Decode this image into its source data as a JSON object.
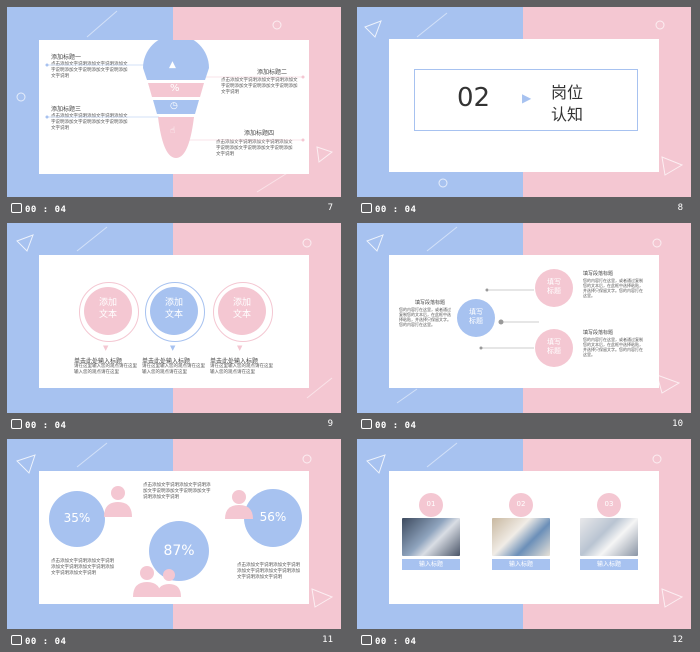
{
  "colors": {
    "blue": "#a7c2f0",
    "pink": "#f4c7d2",
    "bg": "#5f5f61"
  },
  "slides": [
    {
      "time": "00 : 04",
      "num": "7",
      "headings": [
        "添加标题一",
        "添加标题二",
        "添加标题三",
        "添加标题四"
      ],
      "body": "点击添加文字说明添加文字说明添加文字说明添加文字说明添加文字说明添加文字说明",
      "icons": [
        "graduation-cap-icon",
        "percent-icon",
        "clock-icon",
        "hand-pointer-icon"
      ],
      "percent_symbol": "%"
    },
    {
      "time": "00 : 04",
      "num": "8",
      "number": "02",
      "title_line1": "岗位",
      "title_line2": "认知"
    },
    {
      "time": "00 : 04",
      "num": "9",
      "circles": [
        {
          "line1": "添加",
          "line2": "文本"
        },
        {
          "line1": "添加",
          "line2": "文本"
        },
        {
          "line1": "添加",
          "line2": "文本"
        }
      ],
      "caption_title": "单击此处输入标题",
      "caption_body": "请在这里输入您的观点请在这里输入您的观点请在这里"
    },
    {
      "time": "00 : 04",
      "num": "10",
      "center": {
        "line1": "填写",
        "line2": "标题"
      },
      "top": {
        "line1": "填写",
        "line2": "标题"
      },
      "bottom": {
        "line1": "填写",
        "line2": "标题"
      },
      "left_head": "填写段落标题",
      "left_body": "您的内容打在这里，或者通过复制您的文本后，在此框中选择粘贴，并选择只保留文字。您的内容打在这里。",
      "right_head1": "填写段落标题",
      "right_body1": "您的内容打在这里，或者通过复制您的文本后，在此框中选择粘贴，并选择只保留文字。您的内容打在这里。",
      "right_head2": "填写段落标题",
      "right_body2": "您的内容打在这里，或者通过复制您的文本后，在此框中选择粘贴，并选择只保留文字。您的内容打在这里。"
    },
    {
      "time": "00 : 04",
      "num": "11",
      "stats": [
        "35%",
        "87%",
        "56%"
      ],
      "body": "点击添加文字说明添加文字说明添加文字说明添加文字说明添加文字说明添加文字说明"
    },
    {
      "time": "00 : 04",
      "num": "12",
      "items": [
        {
          "n": "01",
          "label": "输入标题"
        },
        {
          "n": "02",
          "label": "输入标题"
        },
        {
          "n": "03",
          "label": "输入标题"
        }
      ]
    }
  ]
}
